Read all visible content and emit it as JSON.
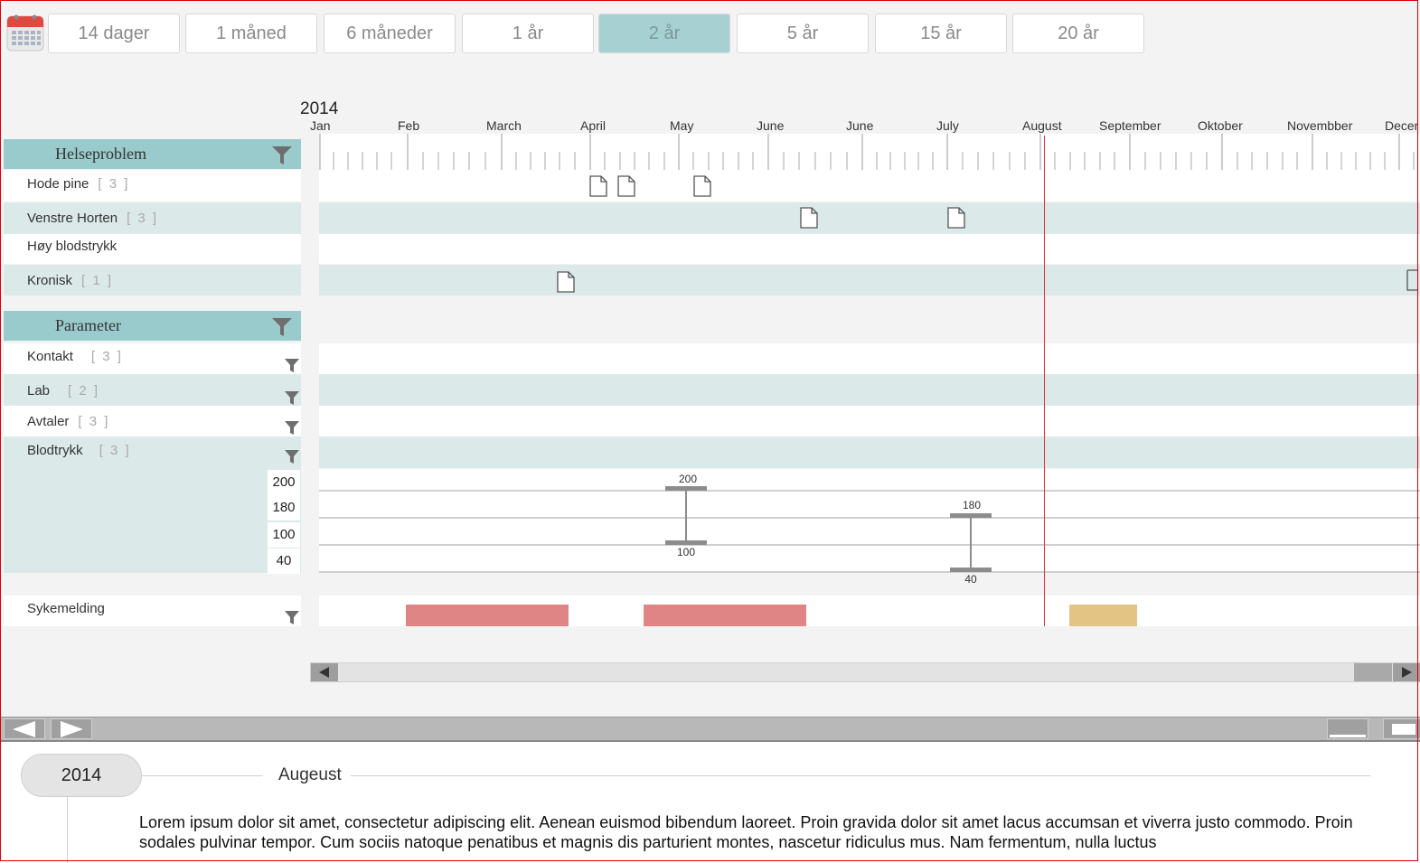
{
  "range_buttons": [
    "14 dager",
    "1 måned",
    "6 måneder",
    "1 år",
    "2 år",
    "5 år",
    "15 år",
    "20 år"
  ],
  "active_range": "2 år",
  "timeline": {
    "year": "2014",
    "months": [
      "Jan",
      "Feb",
      "March",
      "April",
      "May",
      "June",
      "June",
      "July",
      "August",
      "September",
      "Oktober",
      "Novembber",
      "Decer"
    ]
  },
  "helseproblem": {
    "title": "Helseproblem",
    "rows": [
      {
        "label": "Hode pine",
        "count": "[ 3 ]"
      },
      {
        "label": "Venstre Horten",
        "count": "[ 3 ]"
      },
      {
        "label": "Høy blodstrykk",
        "count": ""
      },
      {
        "label": "Kronisk",
        "count": "[ 1 ]"
      }
    ]
  },
  "parameter": {
    "title": "Parameter",
    "rows": [
      {
        "label": "Kontakt",
        "count": "[ 3 ]"
      },
      {
        "label": "Lab",
        "count": "[ 2 ]"
      },
      {
        "label": "Avtaler",
        "count": "[ 3 ]"
      },
      {
        "label": "Blodtrykk",
        "count": "[ 3 ]"
      }
    ]
  },
  "blodtrykk_chart": {
    "y_ticks": [
      "200",
      "180",
      "100",
      "40"
    ],
    "readings": [
      {
        "month": "May",
        "high": "200",
        "low": "100"
      },
      {
        "month": "July",
        "high": "180",
        "low": "40"
      }
    ]
  },
  "sykemelding": {
    "label": "Sykemelding"
  },
  "colors": {
    "accent": "#9acbcc",
    "today_line": "#e23030",
    "sick_red": "#e08585",
    "sick_yellow": "#e3c484"
  },
  "detail": {
    "year": "2014",
    "month": "Augeust",
    "text": "Lorem ipsum dolor sit amet, consectetur adipiscing elit. Aenean euismod bibendum laoreet. Proin gravida dolor sit amet lacus accumsan et viverra justo commodo. Proin sodales pulvinar tempor. Cum sociis natoque penatibus et magnis dis parturient montes, nascetur ridiculus mus. Nam fermentum, nulla luctus"
  }
}
